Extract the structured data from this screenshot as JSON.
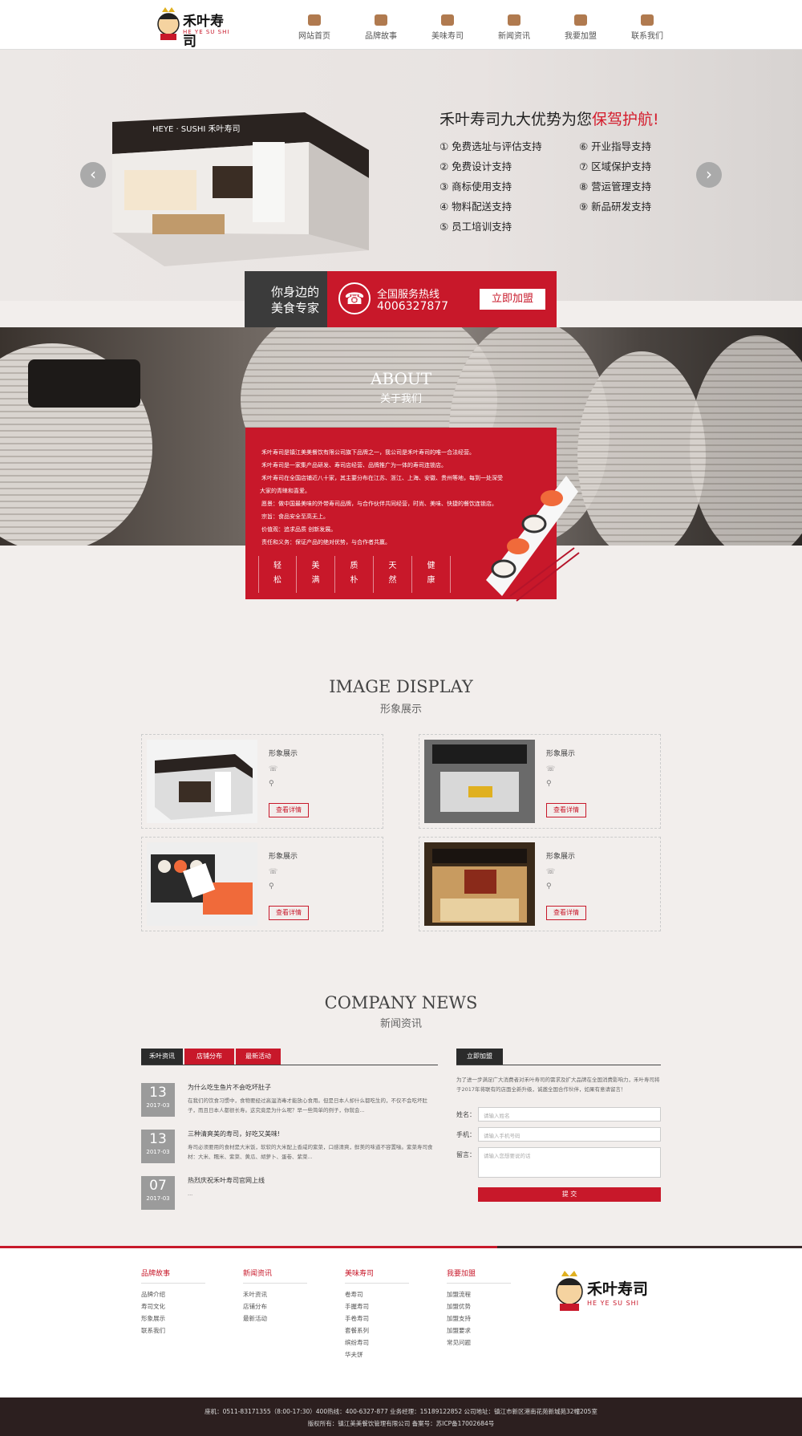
{
  "brand": {
    "logo_text": "禾叶寿司",
    "logo_sub": "HE YE SU SHI"
  },
  "nav": [
    {
      "label": "网站首页",
      "icon": "box-icon"
    },
    {
      "label": "品牌故事",
      "icon": "book-icon"
    },
    {
      "label": "美味寿司",
      "icon": "sushi-icon"
    },
    {
      "label": "新闻资讯",
      "icon": "news-icon"
    },
    {
      "label": "我要加盟",
      "icon": "join-icon"
    },
    {
      "label": "联系我们",
      "icon": "contact-icon"
    }
  ],
  "hero": {
    "title_prefix": "禾叶寿司九大优势为您",
    "title_highlight": "保驾护航!",
    "booth_sign": "HEYE · SUSHI 禾叶寿司",
    "advantages_left": [
      "① 免费选址与评估支持",
      "② 免费设计支持",
      "③ 商标使用支持",
      "④ 物料配送支持",
      "⑤ 员工培训支持"
    ],
    "advantages_right": [
      "⑥ 开业指导支持",
      "⑦ 区域保护支持",
      "⑧ 营运管理支持",
      "⑨ 新品研发支持"
    ],
    "prev": "‹",
    "next": "›"
  },
  "hotline": {
    "left_line1": "你身边的",
    "left_line2": "美食专家",
    "label": "全国服务热线",
    "number": "4006327877",
    "join": "立即加盟"
  },
  "about": {
    "title_en": "ABOUT",
    "title_cn": "关于我们",
    "lines": [
      "禾叶寿司是镇江美美餐饮有限公司旗下品牌之一，我公司是禾叶寿司的唯一合法经营。",
      "禾叶寿司是一家集产品研发、寿司店经营、品牌推广为一体的寿司连锁店。",
      "禾叶寿司在全国店铺近八十家，其主要分布在江苏、浙江、上海、安徽、贵州等地，每到一处深受",
      "大家的青睐和喜爱。",
      "愿景：做中国最美味的外带寿司品牌，与合作伙伴共同经营，时尚、美味、快捷的餐饮连锁店。",
      "宗旨：食品安全至高无上。",
      "价值观：追求品质 创新发展。",
      "责任和义务：保证产品的绝对优势，与合作者共赢。"
    ],
    "values": [
      [
        "轻",
        "松"
      ],
      [
        "美",
        "满"
      ],
      [
        "质",
        "朴"
      ],
      [
        "天",
        "然"
      ],
      [
        "健",
        "康"
      ]
    ]
  },
  "image_display": {
    "title_en": "IMAGE DISPLAY",
    "title_cn": "形象展示",
    "cards": [
      {
        "title": "形象展示",
        "btn": "查看详情"
      },
      {
        "title": "形象展示",
        "btn": "查看详情"
      },
      {
        "title": "形象展示",
        "btn": "查看详情"
      },
      {
        "title": "形象展示",
        "btn": "查看详情"
      }
    ]
  },
  "news": {
    "title_en": "COMPANY NEWS",
    "title_cn": "新闻资讯",
    "tabs": [
      "禾叶资讯",
      "店铺分布",
      "最新活动"
    ],
    "items": [
      {
        "day": "13",
        "ym": "2017-03",
        "title": "为什么吃生鱼片不会吃坏肚子",
        "text": "在我们的饮食习惯中，食物要经过高温消毒才能放心食用。但是日本人却什么都吃生的，不仅不会吃坏肚子，而且日本人都很长寿。这究竟是为什么呢？早一些简单的例子，你就会..."
      },
      {
        "day": "13",
        "ym": "2017-03",
        "title": "三种清爽美的寿司，好吃又美味!",
        "text": "寿司必须要用的食材是大米饭，软软的大米配上香咸的紫菜，口感清爽，鲜美的味道不容置喙。紫菜寿司食材：大米、糯米、紫菜、黄瓜、胡萝卜、蛋卷、紫菜..."
      },
      {
        "day": "07",
        "ym": "2017-03",
        "title": "热烈庆祝禾叶寿司官网上线",
        "text": "..."
      }
    ],
    "join_tab": "立即加盟",
    "join_intro": "为了进一步满足广大消费者对禾叶寿司的需求及扩大品牌在全国消费影响力，禾叶寿司将于2017年将联有的店面全新升级，诚邀全国合作伙伴，如果有意请留言！",
    "form": {
      "name_label": "姓名：",
      "name_ph": "请输入姓名",
      "phone_label": "手机：",
      "phone_ph": "请输入手机号码",
      "msg_label": "留言：",
      "msg_ph": "请输入您想要说的话",
      "submit": "提 交"
    }
  },
  "footer": {
    "cols": [
      {
        "head": "品牌故事",
        "items": [
          "品牌介绍",
          "寿司文化",
          "形象展示",
          "联系我们"
        ]
      },
      {
        "head": "新闻资讯",
        "items": [
          "禾叶资讯",
          "店铺分布",
          "最新活动"
        ]
      },
      {
        "head": "美味寿司",
        "items": [
          "卷寿司",
          "手握寿司",
          "手卷寿司",
          "套餐系列",
          "缤纷寿司",
          "华夫饼"
        ]
      },
      {
        "head": "我要加盟",
        "items": [
          "加盟流程",
          "加盟优势",
          "加盟支持",
          "加盟要求",
          "常见问题"
        ]
      }
    ],
    "line1": "座机：0511-83171355（8:00-17:30）400热线：400-6327-877 业务经理：15189122852 公司地址：镇江市新区港南花苑新城苑32幢205室",
    "line2": "版权所有：镇江美美餐饮管理有限公司 备案号：苏ICP备17002684号"
  },
  "colors": {
    "accent": "#c8182a",
    "dark": "#3b3b3b",
    "footer_bg": "#2c1f1f"
  }
}
